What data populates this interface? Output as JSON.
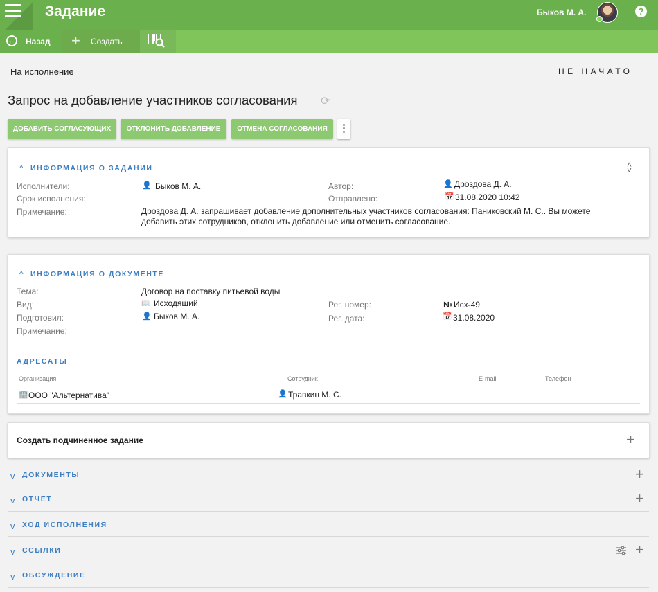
{
  "header": {
    "title": "Задание",
    "user": "Быков М. А.",
    "help": "?"
  },
  "toolbar": {
    "back": "Назад",
    "create": "Создать"
  },
  "status": {
    "left": "На исполнение",
    "right": "НЕ НАЧАТО"
  },
  "page": {
    "title": "Запрос на добавление участников согласования"
  },
  "actions": [
    {
      "label": "ДОБАВИТЬ СОГЛАСУЮЩИХ"
    },
    {
      "label": "ОТКЛОНИТЬ ДОБАВЛЕНИЕ"
    },
    {
      "label": "ОТМЕНА СОГЛАСОВАНИЯ"
    }
  ],
  "task_info": {
    "title": "ИНФОРМАЦИЯ О ЗАДАНИИ",
    "executors_label": "Исполнители:",
    "executors": "Быков М. А.",
    "deadline_label": "Срок исполнения:",
    "note_label": "Примечание:",
    "note_line1": "Дроздова Д. А. запрашивает добавление дополнительных участников согласования: Паниковский М. С.. Вы можете",
    "note_line2": "добавить этих сотрудников, отклонить добавление или отменить согласование.",
    "author_label": "Автор:",
    "author": "Дроздова Д. А.",
    "sent_label": "Отправлено:",
    "sent": "31.08.2020 10:42"
  },
  "doc_info": {
    "title": "ИНФОРМАЦИЯ О ДОКУМЕНТЕ",
    "subject_label": "Тема:",
    "subject": "Договор на поставку питьевой воды",
    "kind_label": "Вид:",
    "kind": "Исходящий",
    "prepared_label": "Подготовил:",
    "prepared": "Быков М. А.",
    "note_label": "Примечание:",
    "reg_num_label": "Рег. номер:",
    "reg_num": "Исх-49",
    "reg_num_prefix": "№",
    "reg_date_label": "Рег. дата:",
    "reg_date": "31.08.2020"
  },
  "addressees": {
    "title": "АДРЕСАТЫ",
    "columns": [
      "Организация",
      "Сотрудник",
      "E-mail",
      "Телефон"
    ],
    "rows": [
      {
        "org": "ООО \"Альтернатива\"",
        "employee": "Травкин М. С.",
        "email": "",
        "phone": ""
      }
    ]
  },
  "subtask": {
    "label": "Создать подчиненное задание"
  },
  "sections": [
    {
      "title": "ДОКУМЕНТЫ"
    },
    {
      "title": "ОТЧЕТ"
    },
    {
      "title": "ХОД ИСПОЛНЕНИЯ"
    },
    {
      "title": "ССЫЛКИ"
    },
    {
      "title": "ОБСУЖДЕНИЕ"
    }
  ]
}
